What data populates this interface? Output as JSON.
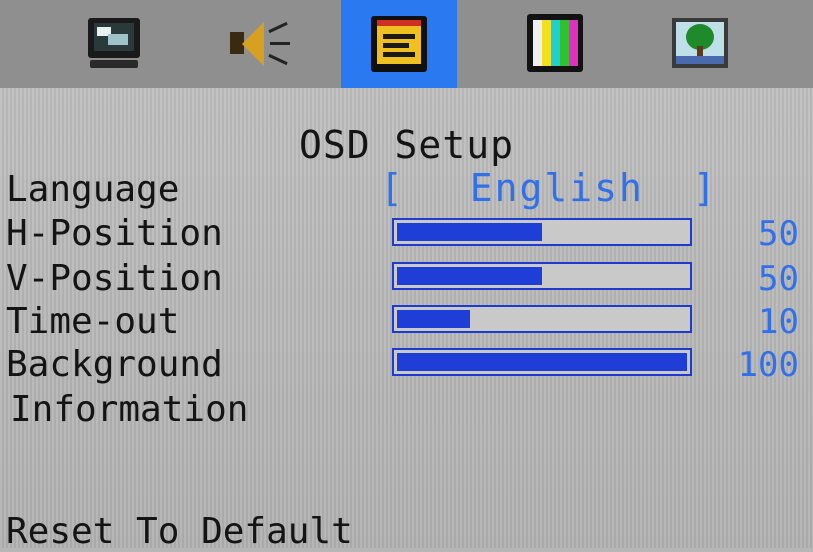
{
  "tabs": [
    {
      "icon": "display-icon",
      "active": false
    },
    {
      "icon": "audio-icon",
      "active": false
    },
    {
      "icon": "osd-setup-icon",
      "active": true
    },
    {
      "icon": "color-bars-icon",
      "active": false
    },
    {
      "icon": "picture-icon",
      "active": false
    }
  ],
  "colors": {
    "active_tab": "#2b79f0",
    "value_text": "#3070e8",
    "slider_fill": "#1f3ed8",
    "label_text": "#141414"
  },
  "menu": {
    "title": "OSD Setup",
    "language": {
      "label": "Language",
      "value": "English",
      "bracket_open": "[",
      "bracket_close": "]"
    },
    "h_position": {
      "label": "H-Position",
      "value": "50",
      "fraction": 0.5
    },
    "v_position": {
      "label": "V-Position",
      "value": "50",
      "fraction": 0.5
    },
    "timeout": {
      "label": "Time-out",
      "value": "10",
      "fraction": 0.25
    },
    "background": {
      "label": "Background",
      "value": "100",
      "fraction": 1.0
    },
    "information": {
      "label": "Information"
    },
    "reset": {
      "label": "Reset To Default"
    }
  }
}
